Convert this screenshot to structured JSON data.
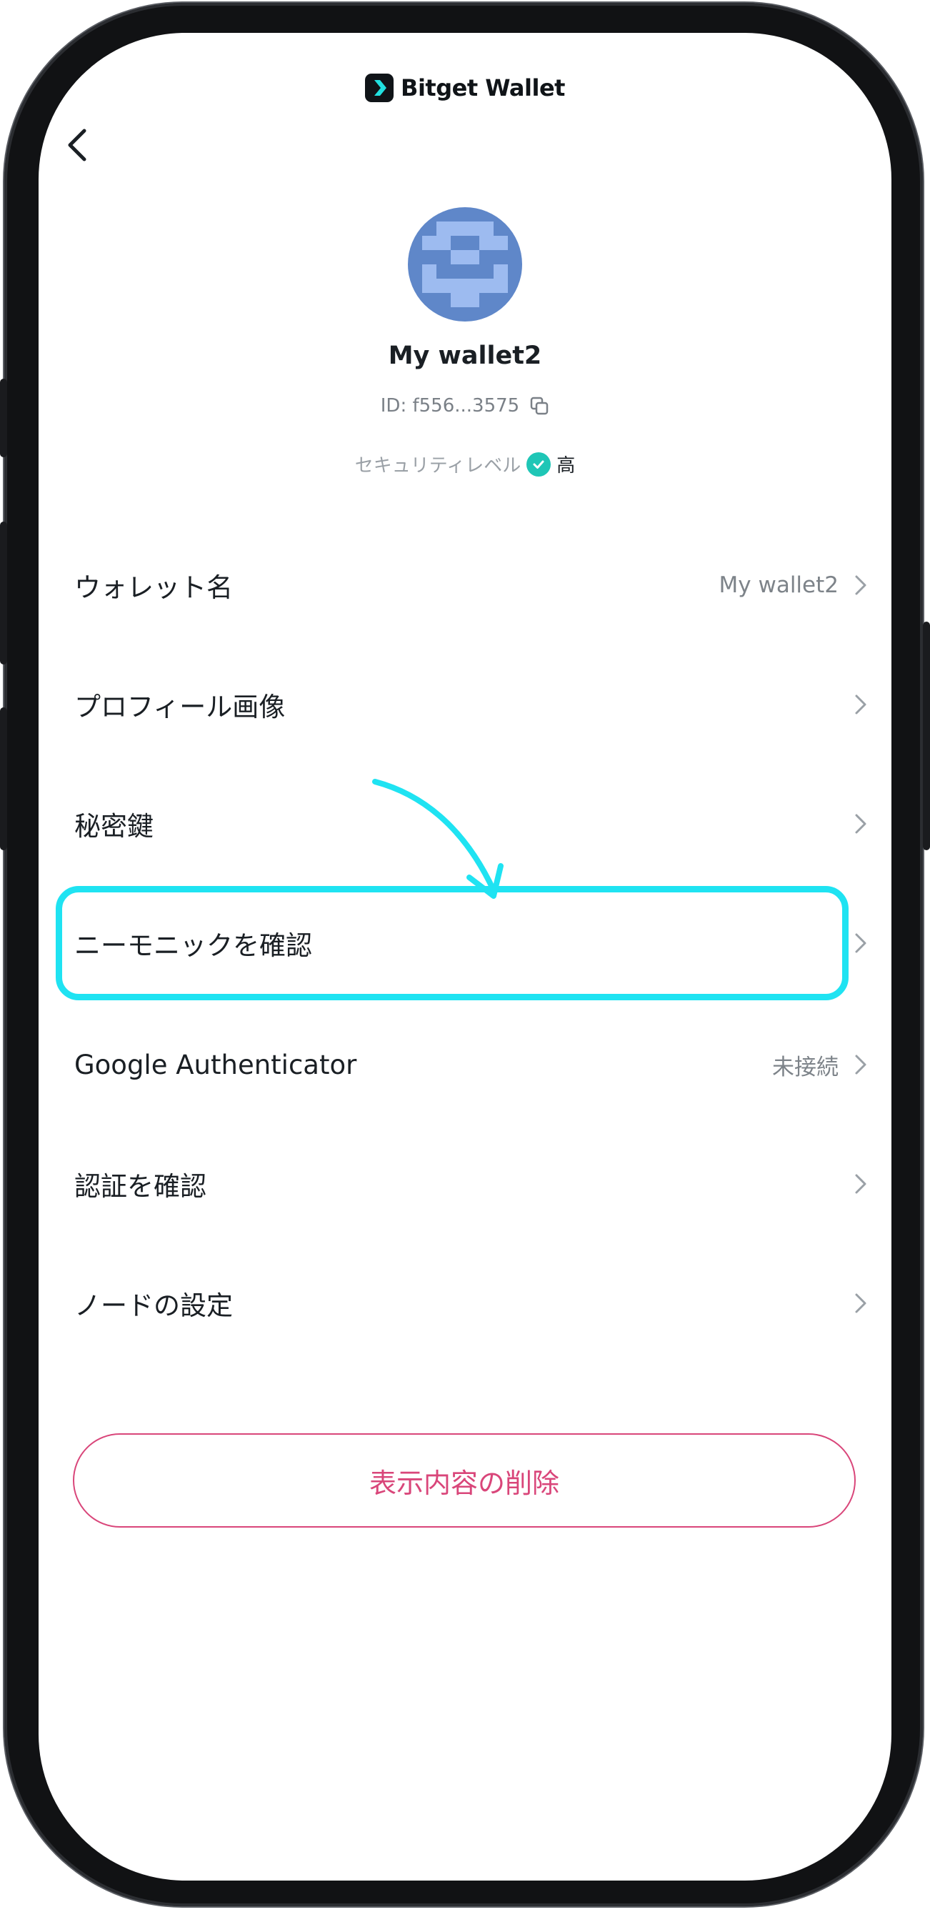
{
  "brand": {
    "name": "Bitget Wallet",
    "icon": "bitget-logo-icon"
  },
  "header": {
    "back_icon": "chevron-left-icon"
  },
  "profile": {
    "wallet_name": "My wallet2",
    "wallet_id": "ID: f556...3575",
    "copy_icon": "copy-icon",
    "security_label": "セキュリティレベル",
    "security_level": "高",
    "security_icon": "check-circle-icon",
    "accent_color": "#1fc6b6"
  },
  "menu": [
    {
      "label": "ウォレット名",
      "value": "My wallet2"
    },
    {
      "label": "プロフィール画像",
      "value": ""
    },
    {
      "label": "秘密鍵",
      "value": ""
    },
    {
      "label": "ニーモニックを確認",
      "value": ""
    },
    {
      "label": "Google Authenticator",
      "value": "未接続"
    },
    {
      "label": "認証を確認",
      "value": ""
    },
    {
      "label": "ノードの設定",
      "value": ""
    }
  ],
  "highlight": {
    "color": "#1fe3f2",
    "target": "ニーモニックを確認"
  },
  "delete_button": {
    "label": "表示内容の削除",
    "color": "#d9467a"
  }
}
